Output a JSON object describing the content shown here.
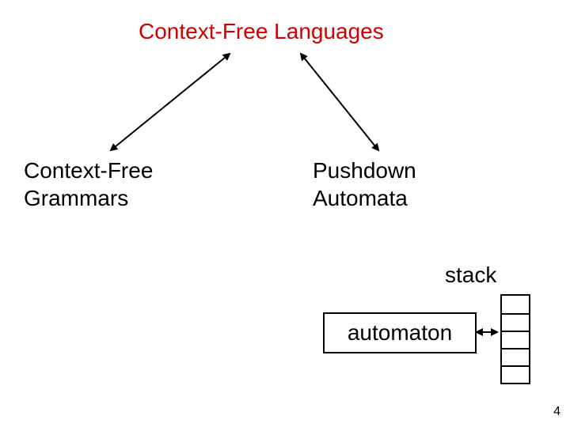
{
  "title": "Context-Free Languages",
  "left_label": "Context-Free\nGrammars",
  "right_label": "Pushdown\nAutomata",
  "stack_label": "stack",
  "automaton_label": "automaton",
  "slide_number": "4",
  "stack_cells": 5
}
